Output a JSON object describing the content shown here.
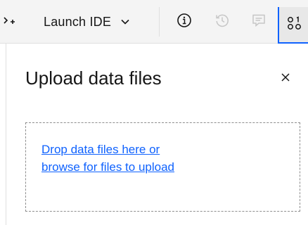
{
  "toolbar": {
    "launch_label": "Launch IDE",
    "icons": [
      "collapse-icon",
      "chevron-down-icon",
      "information-icon",
      "history-icon",
      "comment-icon",
      "data-icon"
    ]
  },
  "panel": {
    "title": "Upload data files",
    "close_symbol": "×",
    "drop_line1": "Drop data files here or",
    "drop_line2": "browse for files to upload"
  },
  "colors": {
    "accent": "#0f62fe",
    "toolbar_bg": "#f4f4f4",
    "text": "#161616",
    "disabled_icon": "#c6c6c6"
  }
}
